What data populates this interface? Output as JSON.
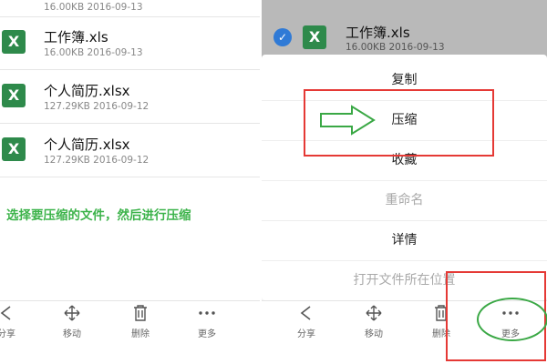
{
  "left_panel": {
    "files": [
      {
        "name": "工作簿.xls",
        "meta": "16.00KB  2016-09-13"
      },
      {
        "name": "个人简历.xlsx",
        "meta": "127.29KB  2016-09-12"
      },
      {
        "name": "个人简历.xlsx",
        "meta": "127.29KB  2016-09-12"
      }
    ],
    "partial_meta": "16.00KB  2016-09-13",
    "hint": "选择要压缩的文件，然后进行压缩"
  },
  "toolbar": {
    "share": "分享",
    "move": "移动",
    "delete": "删除",
    "more": "更多"
  },
  "right_panel": {
    "selected_file": {
      "name": "工作簿.xls",
      "meta": "16.00KB  2016-09-13"
    },
    "menu": {
      "copy": "复制",
      "compress": "压缩",
      "favorite": "收藏",
      "rename": "重命名",
      "details": "详情",
      "open_location": "打开文件所在位置"
    }
  },
  "icons": {
    "xls_letter": "X",
    "checkmark": "✓"
  },
  "colors": {
    "excel_green": "#2e8a4b",
    "hint_green": "#3cb34a",
    "annotation_red": "#e53935",
    "annotation_green": "#3aa845",
    "check_blue": "#2f7ad6"
  }
}
